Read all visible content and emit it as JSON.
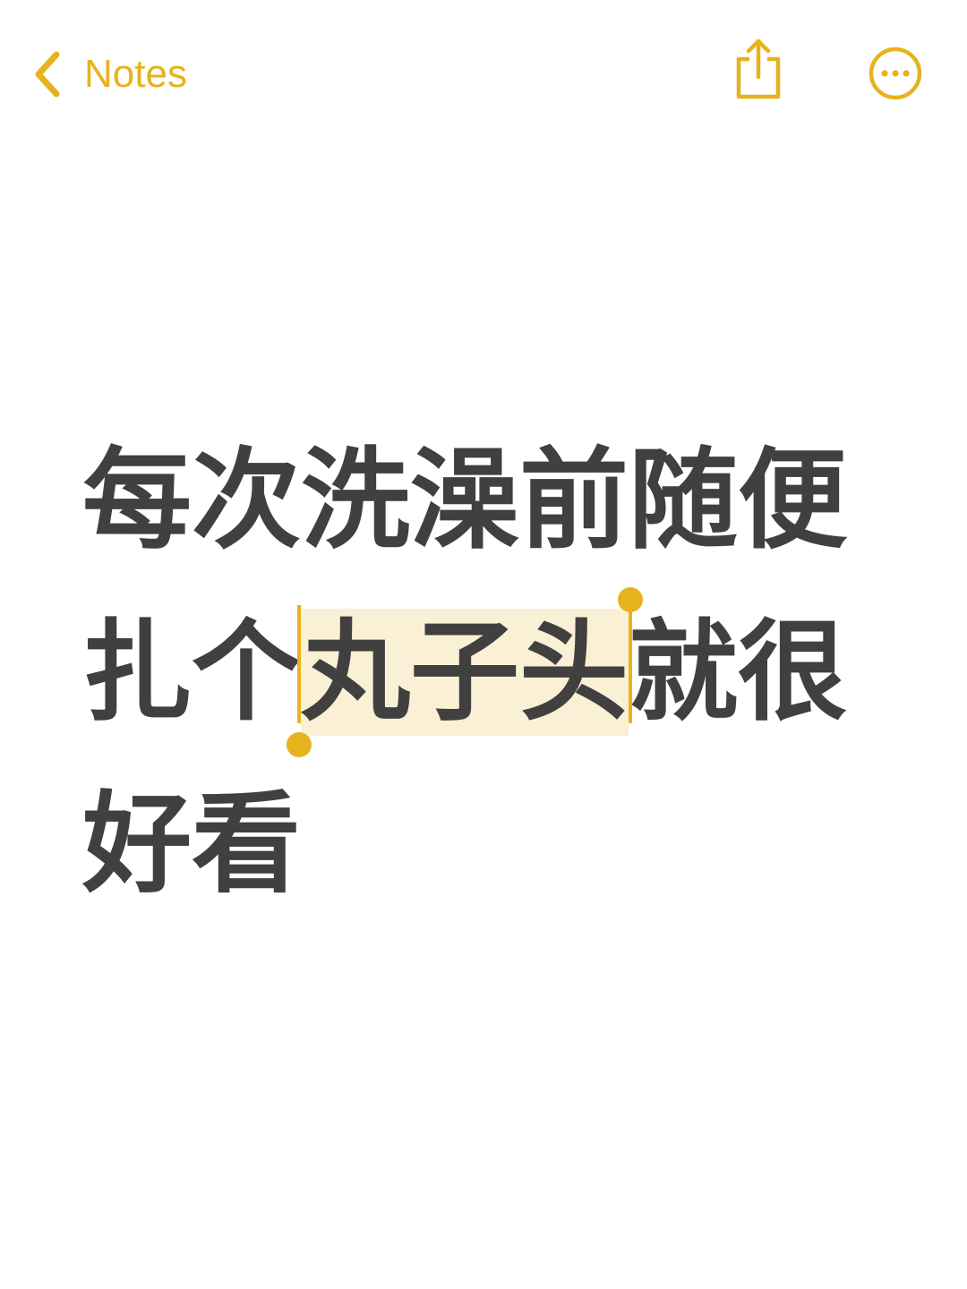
{
  "nav": {
    "back_label": "Notes",
    "back_icon": "chevron-left-icon",
    "share_icon": "share-icon",
    "more_icon": "ellipsis-circle-icon",
    "accent_color": "#E6B31E"
  },
  "note": {
    "lines": [
      {
        "text": "每次洗澡前随便"
      },
      {
        "before": "扎个",
        "selected": "丸子头",
        "after": "就很"
      },
      {
        "text": "好看"
      }
    ],
    "text_color": "#404040",
    "selection_color": "#FAF0D5"
  }
}
